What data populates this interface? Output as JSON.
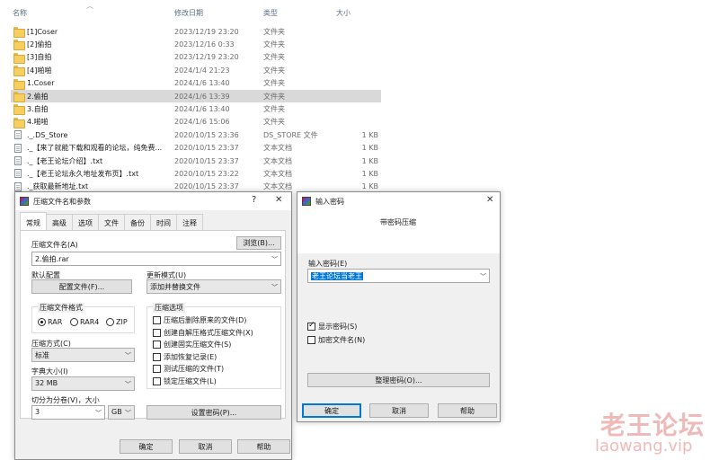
{
  "explorer": {
    "columns": {
      "name": "名称",
      "date": "修改日期",
      "type": "类型",
      "size": "大小"
    },
    "files": [
      {
        "icon": "folder-icon",
        "name": "[1]Coser",
        "date": "2023/12/19 23:20",
        "type": "文件夹",
        "size": ""
      },
      {
        "icon": "folder-icon",
        "name": "[2]偷拍",
        "date": "2023/12/16 0:33",
        "type": "文件夹",
        "size": ""
      },
      {
        "icon": "folder-icon",
        "name": "[3]自拍",
        "date": "2023/12/19 23:20",
        "type": "文件夹",
        "size": ""
      },
      {
        "icon": "folder-icon",
        "name": "[4]啪啪",
        "date": "2024/1/4 21:23",
        "type": "文件夹",
        "size": ""
      },
      {
        "icon": "folder-icon",
        "name": "1.Coser",
        "date": "2024/1/6 13:40",
        "type": "文件夹",
        "size": ""
      },
      {
        "icon": "folder-icon",
        "name": "2.偷拍",
        "date": "2024/1/6 13:39",
        "type": "文件夹",
        "size": "",
        "selected": true
      },
      {
        "icon": "folder-icon",
        "name": "3.自拍",
        "date": "2024/1/6 13:40",
        "type": "文件夹",
        "size": ""
      },
      {
        "icon": "folder-icon",
        "name": "4.啪啪",
        "date": "2024/1/6 15:06",
        "type": "文件夹",
        "size": ""
      },
      {
        "icon": "file-icon",
        "name": "._.DS_Store",
        "date": "2020/10/15 23:36",
        "type": "DS_STORE 文件",
        "size": "1 KB"
      },
      {
        "icon": "file-icon",
        "name": "._【来了就能下载和观看的论坛，纯免费...",
        "date": "2020/10/15 23:37",
        "type": "文本文档",
        "size": "1 KB"
      },
      {
        "icon": "file-icon",
        "name": "._【老王论坛介绍】.txt",
        "date": "2020/10/15 23:37",
        "type": "文本文档",
        "size": "1 KB"
      },
      {
        "icon": "file-icon",
        "name": "._【老王论坛永久地址发布页】.txt",
        "date": "2020/10/15 23:22",
        "type": "文本文档",
        "size": "1 KB"
      },
      {
        "icon": "file-icon",
        "name": "._获取最新地址.txt",
        "date": "2020/10/15 23:37",
        "type": "文本文档",
        "size": "1 KB"
      }
    ]
  },
  "archive_dialog": {
    "title": "压缩文件名和参数",
    "help_mark": "?",
    "close_mark": "✕",
    "tabs": [
      "常规",
      "高级",
      "选项",
      "文件",
      "备份",
      "时间",
      "注释"
    ],
    "archive_name_label": "压缩文件名(A)",
    "archive_name_value": "2.偷拍.rar",
    "browse_button": "浏览(B)...",
    "default_profile_label": "默认配置",
    "profiles_button": "配置文件(F)...",
    "update_mode_label": "更新模式(U)",
    "update_mode_value": "添加并替换文件",
    "format_group": "压缩文件格式",
    "formats": [
      "RAR",
      "RAR4",
      "ZIP"
    ],
    "format_selected": "RAR",
    "method_label": "压缩方式(C)",
    "method_value": "标准",
    "dict_label": "字典大小(I)",
    "dict_value": "32 MB",
    "split_label": "切分为分卷(V)，大小",
    "split_value": "3",
    "split_unit": "GB",
    "options_group": "压缩选项",
    "options": [
      {
        "label": "压缩后删除原来的文件(D)",
        "checked": false
      },
      {
        "label": "创建自解压格式压缩文件(X)",
        "checked": false
      },
      {
        "label": "创建固实压缩文件(S)",
        "checked": false
      },
      {
        "label": "添加恢复记录(E)",
        "checked": false
      },
      {
        "label": "测试压缩的文件(T)",
        "checked": false
      },
      {
        "label": "锁定压缩文件(L)",
        "checked": false
      }
    ],
    "set_password_button": "设置密码(P)...",
    "ok_button": "确定",
    "cancel_button": "取消",
    "help_button": "帮助"
  },
  "password_dialog": {
    "title": "输入密码",
    "close_mark": "✕",
    "heading": "带密码压缩",
    "password_label": "输入密码(E)",
    "password_value": "老王论坛当老王",
    "show_password": {
      "label": "显示密码(S)",
      "checked": true
    },
    "encrypt_names": {
      "label": "加密文件名(N)",
      "checked": false
    },
    "organize_button": "整理密码(O)...",
    "ok_button": "确定",
    "cancel_button": "取消",
    "help_button": "帮助"
  },
  "watermark": {
    "title": "老王论坛",
    "url": "laowang.vip"
  },
  "colors": {
    "selection": "#d9d9d9",
    "accent": "#0078d7",
    "folder": "#f6cf5e"
  }
}
